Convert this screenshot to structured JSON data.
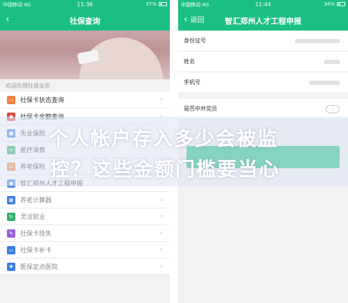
{
  "left": {
    "status": {
      "carrier": "中国移动 4G",
      "time": "11:36",
      "battery": "37%"
    },
    "nav": {
      "back_icon": "chevron-left",
      "title": "社保查询"
    },
    "section_title": "欢迎办理社保业务",
    "items": [
      {
        "label": "社保卡状态查询",
        "icon": "card-icon",
        "color": "#f0803c"
      },
      {
        "label": "社保卡余额查询",
        "icon": "wallet-icon",
        "color": "#e2483d"
      },
      {
        "label": "失业保险",
        "icon": "briefcase-icon",
        "color": "#3b7de0"
      },
      {
        "label": "医疗消费",
        "icon": "medical-icon",
        "color": "#2fb36b"
      },
      {
        "label": "养老保险",
        "icon": "person-icon",
        "color": "#f0803c"
      },
      {
        "label": "智汇郑州人才工程申报",
        "icon": "user-icon",
        "color": "#3b7de0"
      },
      {
        "label": "养老计算器",
        "icon": "calculator-icon",
        "color": "#3b7de0"
      },
      {
        "label": "灵活就业",
        "icon": "refresh-icon",
        "color": "#2fb36b"
      },
      {
        "label": "社保卡挂失",
        "icon": "pen-icon",
        "color": "#9a5fd8"
      },
      {
        "label": "社保卡补卡",
        "icon": "card-plus-icon",
        "color": "#3b7de0"
      },
      {
        "label": "医保定点医院",
        "icon": "hospital-icon",
        "color": "#3b7de0"
      }
    ]
  },
  "right": {
    "status": {
      "carrier": "中国移动 4G",
      "time": "11:44",
      "battery": "34%"
    },
    "nav": {
      "back_label": "返回",
      "title": "智汇郑州人才工程申报"
    },
    "fields": [
      {
        "label": "身份证号"
      },
      {
        "label": "姓名"
      },
      {
        "label": "手机号"
      }
    ],
    "party_member_label": "是否中共党员"
  },
  "overlay": {
    "line1": "个人帐户存入多少会被监",
    "line2": "控？这些金额门槛要当心"
  },
  "colors": {
    "brand": "#1bbf84"
  }
}
